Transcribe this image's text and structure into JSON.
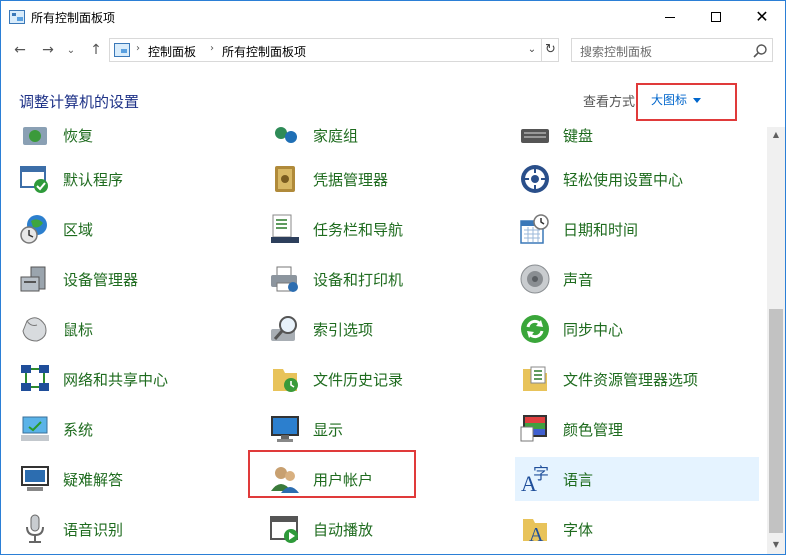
{
  "window": {
    "title": "所有控制面板项",
    "controls": {
      "minimize": "minimize-icon",
      "maximize": "maximize-icon",
      "close": "✕"
    }
  },
  "nav": {
    "back": "←",
    "forward": "→",
    "recent": "⌄",
    "up": "↑",
    "breadcrumb": [
      "控制面板",
      "所有控制面板项"
    ],
    "dropdown": "⌄",
    "refresh": "↻",
    "search_placeholder": "搜索控制面板"
  },
  "header": {
    "title": "调整计算机的设置",
    "view_label": "查看方式",
    "view_value": "大图标"
  },
  "items": [
    {
      "label": "恢复",
      "icon": "recovery-icon"
    },
    {
      "label": "家庭组",
      "icon": "homegroup-icon"
    },
    {
      "label": "键盘",
      "icon": "keyboard-icon"
    },
    {
      "label": "默认程序",
      "icon": "default-programs-icon"
    },
    {
      "label": "凭据管理器",
      "icon": "credential-manager-icon"
    },
    {
      "label": "轻松使用设置中心",
      "icon": "ease-of-access-icon"
    },
    {
      "label": "区域",
      "icon": "region-icon"
    },
    {
      "label": "任务栏和导航",
      "icon": "taskbar-icon"
    },
    {
      "label": "日期和时间",
      "icon": "date-time-icon"
    },
    {
      "label": "设备管理器",
      "icon": "device-manager-icon"
    },
    {
      "label": "设备和打印机",
      "icon": "devices-printers-icon"
    },
    {
      "label": "声音",
      "icon": "sound-icon"
    },
    {
      "label": "鼠标",
      "icon": "mouse-icon"
    },
    {
      "label": "索引选项",
      "icon": "indexing-icon"
    },
    {
      "label": "同步中心",
      "icon": "sync-center-icon"
    },
    {
      "label": "网络和共享中心",
      "icon": "network-icon"
    },
    {
      "label": "文件历史记录",
      "icon": "file-history-icon"
    },
    {
      "label": "文件资源管理器选项",
      "icon": "explorer-options-icon"
    },
    {
      "label": "系统",
      "icon": "system-icon"
    },
    {
      "label": "显示",
      "icon": "display-icon"
    },
    {
      "label": "颜色管理",
      "icon": "color-management-icon"
    },
    {
      "label": "疑难解答",
      "icon": "troubleshooting-icon"
    },
    {
      "label": "用户帐户",
      "icon": "user-accounts-icon"
    },
    {
      "label": "语言",
      "icon": "language-icon"
    },
    {
      "label": "语音识别",
      "icon": "speech-recognition-icon"
    },
    {
      "label": "自动播放",
      "icon": "autoplay-icon"
    },
    {
      "label": "字体",
      "icon": "fonts-icon"
    }
  ],
  "highlighted_items": [
    "大图标",
    "用户帐户"
  ],
  "selected_item": "语言"
}
